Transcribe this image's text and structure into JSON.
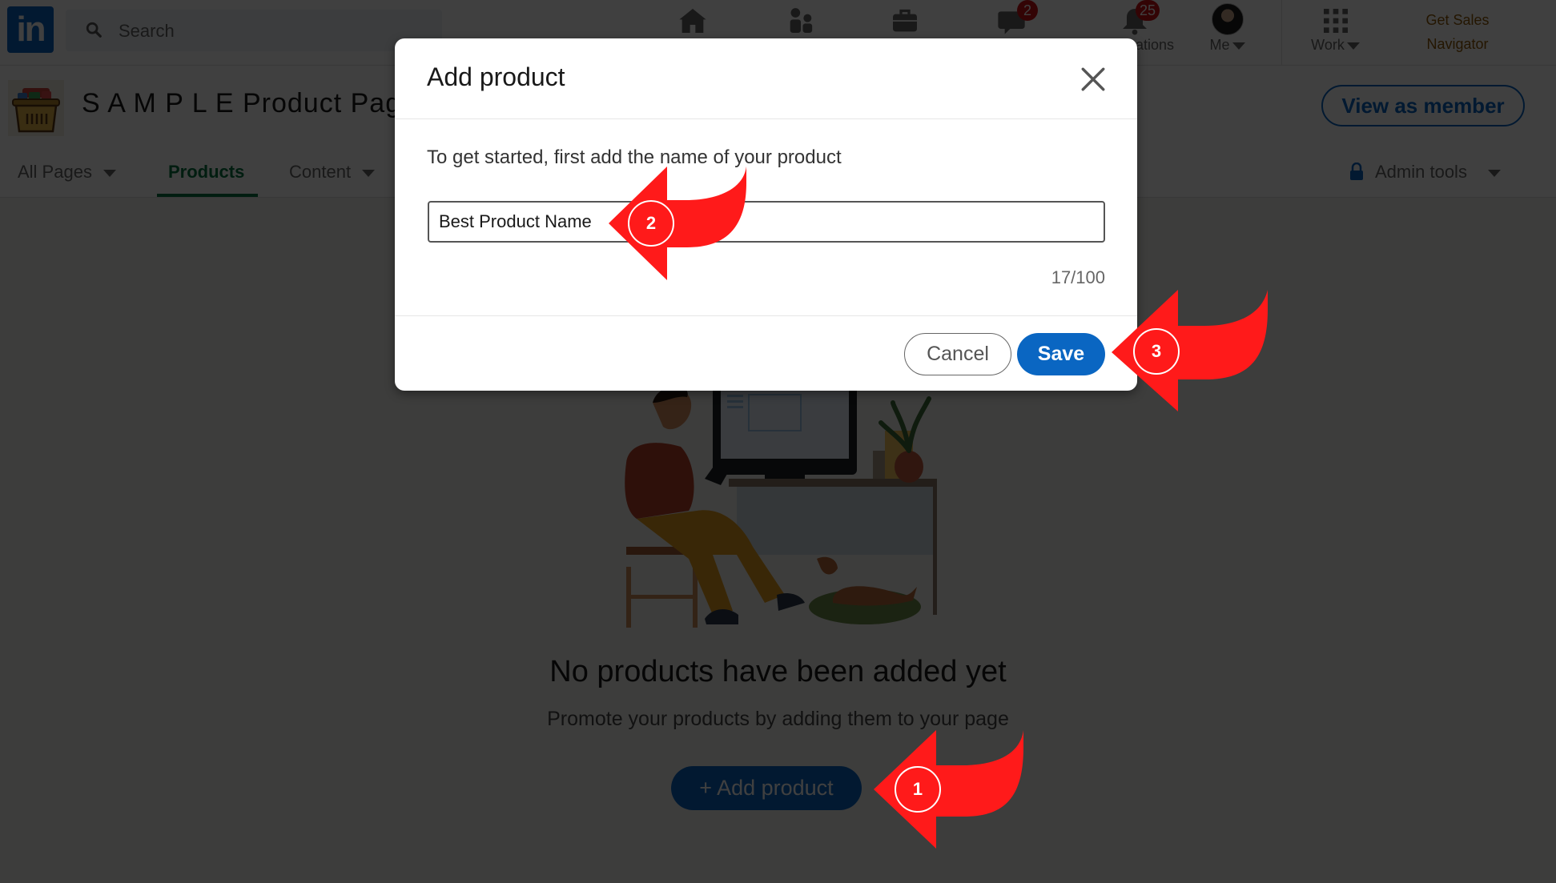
{
  "topnav": {
    "logo": "in",
    "search_placeholder": "Search",
    "items": [
      {
        "name": "home",
        "label": ""
      },
      {
        "name": "my-network",
        "label": ""
      },
      {
        "name": "jobs",
        "label": ""
      },
      {
        "name": "messaging",
        "label": "",
        "badge": "2"
      },
      {
        "name": "notifications",
        "label": "Notifications",
        "badge": "25"
      },
      {
        "name": "me",
        "label": "Me"
      },
      {
        "name": "work",
        "label": "Work"
      }
    ],
    "sales_navigator": "Get Sales\nNavigator",
    "sales_line1": "Get Sales",
    "sales_line2": "Navigator"
  },
  "company": {
    "name": "S A M P L E Product Page",
    "view_as_member": "View as member",
    "tabs": [
      {
        "label": "All Pages",
        "dropdown": true,
        "active": false
      },
      {
        "label": "Products",
        "dropdown": false,
        "active": true
      },
      {
        "label": "Content",
        "dropdown": true,
        "active": false
      }
    ],
    "admin_tools": "Admin tools"
  },
  "empty_state": {
    "title": "No products have been added yet",
    "subtitle": "Promote your products by adding them to your page",
    "add_button": "+ Add product"
  },
  "modal": {
    "title": "Add product",
    "prompt": "To get started, first add the name of your product",
    "input_value": "Best Product Name",
    "counter": "17/100",
    "cancel": "Cancel",
    "save": "Save"
  },
  "callouts": [
    {
      "step": "1",
      "target": "add-product-button"
    },
    {
      "step": "2",
      "target": "product-name-input"
    },
    {
      "step": "3",
      "target": "save-button"
    }
  ],
  "colors": {
    "brand": "#0a66c2",
    "active_tab": "#057642",
    "callout": "#ff1a1a",
    "badge": "#cc1016"
  }
}
